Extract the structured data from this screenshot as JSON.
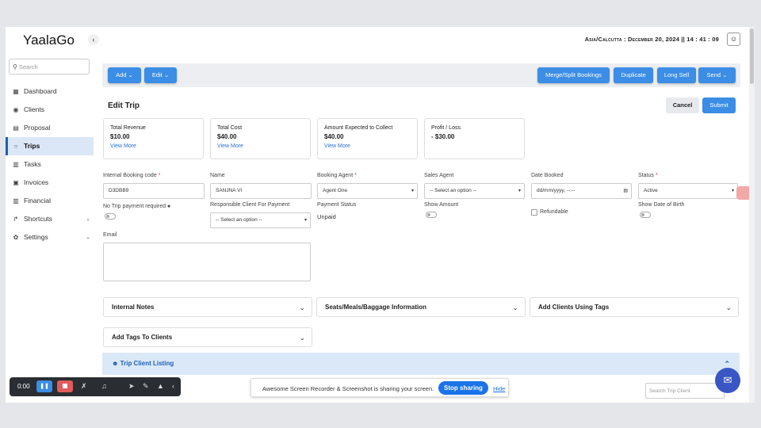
{
  "app": {
    "logo": "YaalaGo",
    "collapse_icon": "‹",
    "timezone": "Asia/Calcutta : December 20, 2024 || 14 : 41 : 09",
    "user_icon": "user-icon"
  },
  "sidebar": {
    "search_placeholder": "Search",
    "items": [
      {
        "label": "Dashboard",
        "icon": "▦"
      },
      {
        "label": "Clients",
        "icon": "◉"
      },
      {
        "label": "Proposal",
        "icon": "▤"
      },
      {
        "label": "Trips",
        "icon": "○"
      },
      {
        "label": "Tasks",
        "icon": "▥"
      },
      {
        "label": "Invoices",
        "icon": "▣"
      },
      {
        "label": "Financial",
        "icon": "▥"
      },
      {
        "label": "Shortcuts",
        "icon": "↱"
      },
      {
        "label": "Settings",
        "icon": "✿"
      }
    ]
  },
  "toolbar": {
    "add": "Add ⌄",
    "edit": "Edit ⌄",
    "merge": "Merge/Split Bookings",
    "duplicate": "Duplicate",
    "long_sell": "Long Sell",
    "send": "Send ⌄"
  },
  "page": {
    "title": "Edit Trip",
    "cancel": "Cancel",
    "submit": "Submit"
  },
  "cards": [
    {
      "label": "Total Revenue",
      "value": "$10.00",
      "more": "View More"
    },
    {
      "label": "Total Cost",
      "value": "$40.00",
      "more": "View More"
    },
    {
      "label": "Amount Expected to Collect",
      "value": "$40.00",
      "more": "View More"
    },
    {
      "label": "Profit / Loss",
      "value": "- $30.00",
      "more": ""
    }
  ],
  "form": {
    "booking_code_label": "Internal Booking code",
    "booking_code_value": "D3DBB9",
    "name_label": "Name",
    "name_value": "SANJNA VI",
    "agent_label": "Booking Agent",
    "agent_value": "Agent One",
    "sales_label": "Sales Agent",
    "sales_value": "-- Select an option --",
    "date_label": "Date Booked",
    "date_value": "dd/mm/yyyy, --:--",
    "status_label": "Status",
    "status_value": "Active",
    "no_trip_label": "No Trip payment required",
    "responsible_label": "Responsible Client For Payment",
    "responsible_value": "-- Select an option --",
    "payment_status_label": "Payment Status",
    "payment_status_value": "Unpaid",
    "show_amount_label": "Show Amount",
    "refundable_label": "Refundable",
    "show_dob_label": "Show Date of Birth",
    "email_label": "Email",
    "required_mark": "*"
  },
  "accordions": {
    "internal_notes": "Internal Notes",
    "seats": "Seats/Meals/Baggage Information",
    "add_clients_tags": "Add Clients Using Tags",
    "add_tags": "Add Tags To Clients",
    "chevron": "⌄"
  },
  "listing": {
    "title": "Trip Client Listing",
    "search_placeholder": "Search Trip Client"
  },
  "recorder": {
    "time": "0:00"
  },
  "share_bar": {
    "text": "Awesome Screen Recorder & Screenshot is sharing your screen.",
    "stop": "Stop sharing",
    "hide": "Hide"
  },
  "colors": {
    "primary": "#3b8de6",
    "active_nav": "#dbe7f7",
    "link": "#2a6fd6"
  }
}
